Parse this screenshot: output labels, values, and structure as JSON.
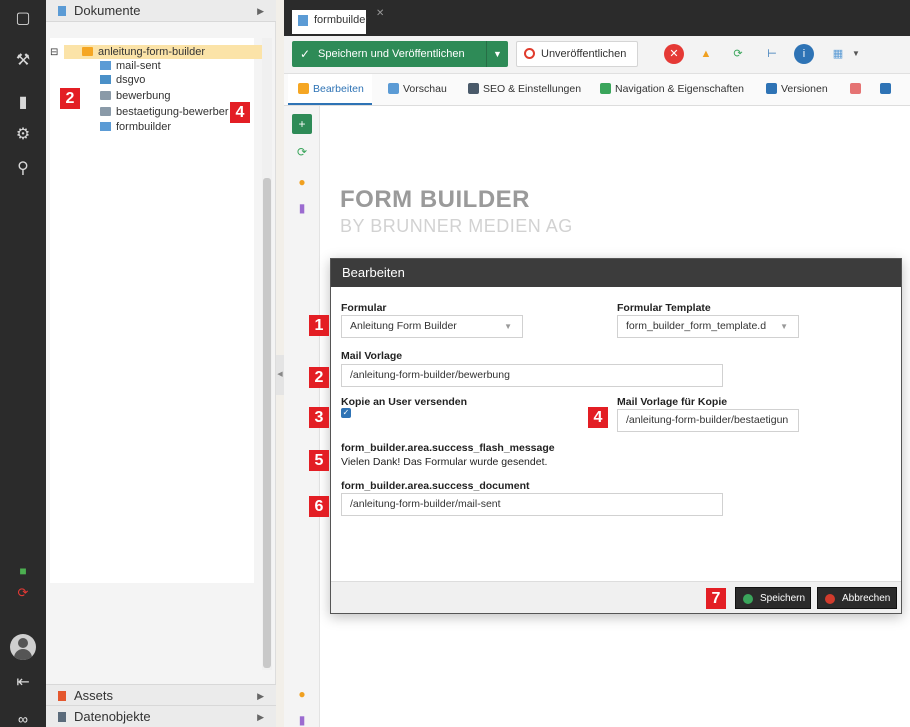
{
  "window": {
    "tab_title": "formbuilder"
  },
  "rail": {
    "icons": [
      "document-icon",
      "wrench-icon",
      "bar-chart-icon",
      "gear-icon",
      "search-icon",
      "chat-icon",
      "refresh-icon",
      "avatar",
      "logout-icon"
    ]
  },
  "tree": {
    "header_label": "Dokumente",
    "root": "anleitung-form-builder",
    "children": [
      {
        "label": "mail-sent",
        "icon": "document-icon"
      },
      {
        "label": "dsgvo",
        "icon": "snippet-icon"
      },
      {
        "label": "bewerbung",
        "icon": "email-icon"
      },
      {
        "label": "bestaetigung-bewerber",
        "icon": "email-icon"
      },
      {
        "label": "formbuilder",
        "icon": "document-icon"
      }
    ],
    "assets_label": "Assets",
    "objects_label": "Datenobjekte"
  },
  "toolbar": {
    "publish_label": "Speichern und Veröffentlichen",
    "unpublish_label": "Unveröffentlichen"
  },
  "subtabs": [
    {
      "label": "Bearbeiten"
    },
    {
      "label": "Vorschau"
    },
    {
      "label": "SEO & Einstellungen"
    },
    {
      "label": "Navigation & Eigenschaften"
    },
    {
      "label": "Versionen"
    }
  ],
  "page": {
    "title": "FORM BUILDER",
    "subtitle": "BY BRUNNER MEDIEN AG"
  },
  "dialog": {
    "title": "Bearbeiten",
    "formular_label": "Formular",
    "formular_value": "Anleitung Form Builder",
    "template_label": "Formular Template",
    "template_value": "form_builder_form_template.d",
    "mail_label": "Mail Vorlage",
    "mail_value": "/anleitung-form-builder/bewerbung",
    "copy_label": "Kopie an User versenden",
    "copy_checked": true,
    "copy_mail_label": "Mail Vorlage für Kopie",
    "copy_mail_value": "/anleitung-form-builder/bestaetigun",
    "flash_label": "form_builder.area.success_flash_message",
    "flash_value": "Vielen Dank! Das Formular wurde gesendet.",
    "doc_label": "form_builder.area.success_document",
    "doc_value": "/anleitung-form-builder/mail-sent",
    "save_label": "Speichern",
    "cancel_label": "Abbrechen"
  },
  "callouts": [
    "1",
    "2",
    "3",
    "4",
    "5",
    "6",
    "7",
    "2",
    "4"
  ],
  "colors": {
    "accent": "#2e73b5",
    "publish": "#2e8b57",
    "callout": "#e31e24",
    "rail": "#2b2b2b"
  }
}
